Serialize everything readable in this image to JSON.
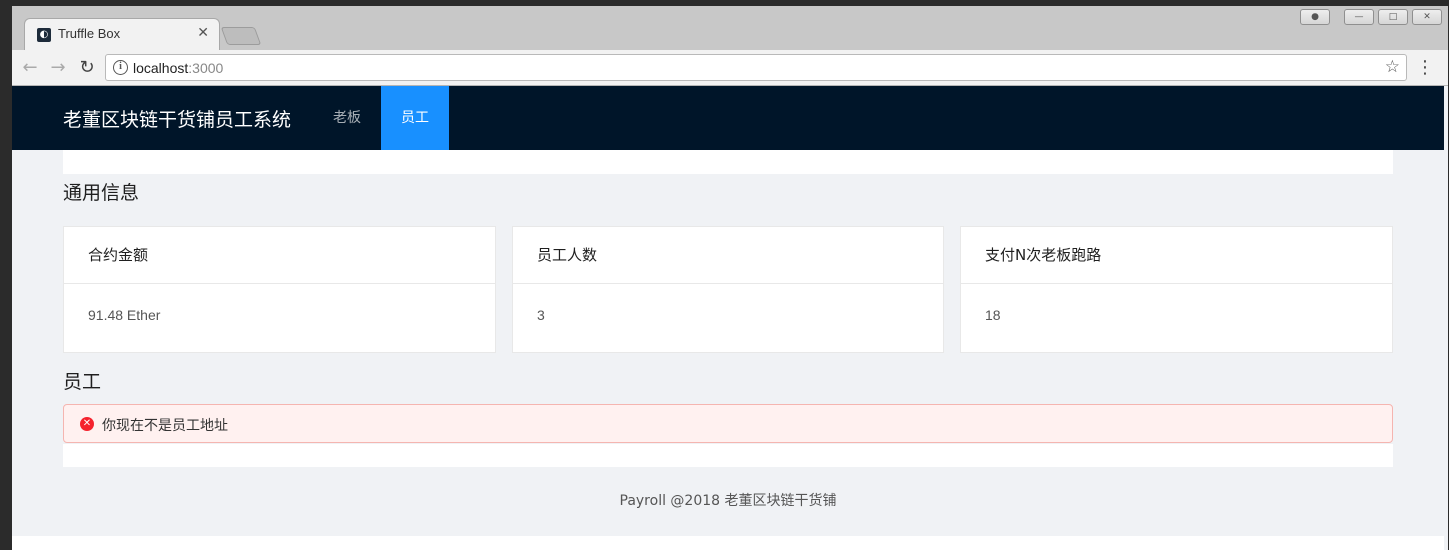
{
  "browser": {
    "tab_title": "Truffle Box",
    "tab_close": "✕",
    "url_host": "localhost",
    "url_port": ":3000"
  },
  "header": {
    "brand": "老董区块链干货铺员工系统",
    "menu": [
      "老板",
      "员工"
    ],
    "active_menu": "员工"
  },
  "general": {
    "title": "通用信息",
    "cards": [
      {
        "title": "合约金额",
        "value": "91.48 Ether"
      },
      {
        "title": "员工人数",
        "value": "3"
      },
      {
        "title": "支付N次老板跑路",
        "value": "18"
      }
    ]
  },
  "staff": {
    "title": "员工",
    "alert": "你现在不是员工地址"
  },
  "footer": "Payroll @2018 老董区块链干货铺",
  "colors": {
    "header_bg": "#001529",
    "active_menu_bg": "#1890ff",
    "alert_bg": "#fff1f0",
    "alert_icon": "#f5222d"
  }
}
